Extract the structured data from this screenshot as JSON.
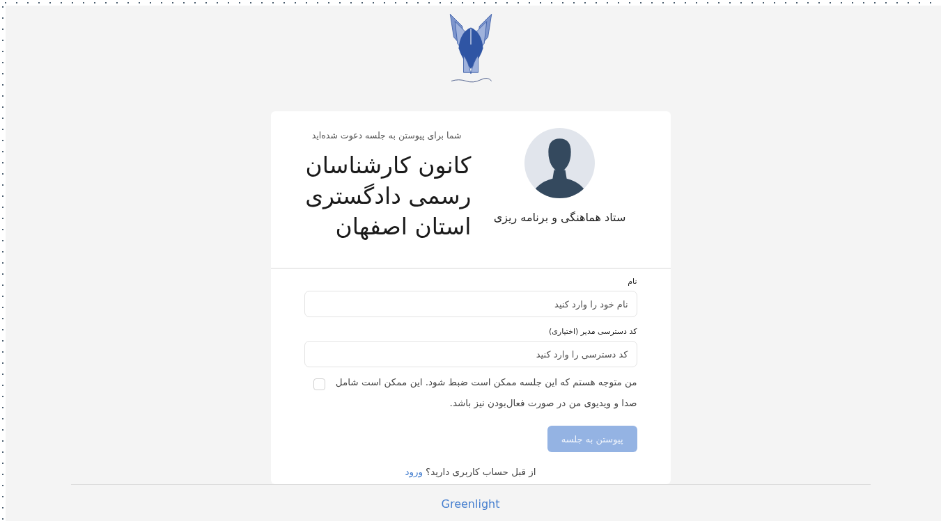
{
  "invite": {
    "subtitle": "شما برای پیوستن به جلسه دعوت شده‌اید",
    "room_title": "کانون کارشناسان رسمی دادگستری استان اصفهان",
    "owner_name": "ستاد هماهنگی و برنامه ریزی"
  },
  "form": {
    "fields": [
      {
        "label": "نام",
        "placeholder": "نام خود را وارد کنید"
      },
      {
        "label": "کد دسترسی مدیر  (اختیاری)",
        "placeholder": "کد دسترسی را وارد کنید"
      }
    ],
    "consent": {
      "text": "من متوجه هستم که این جلسه ممکن است ضبط شود. این ممکن است شامل صدا و ویدیوی من در صورت فعال‌بودن نیز باشد.",
      "checked": false
    },
    "join_button": {
      "label": "پیوستن به جلسه",
      "disabled": true
    },
    "signin_prompt": "از قبل حساب کاربری دارید؟",
    "signin_link": "ورود"
  },
  "footer": {
    "link": "Greenlight"
  }
}
